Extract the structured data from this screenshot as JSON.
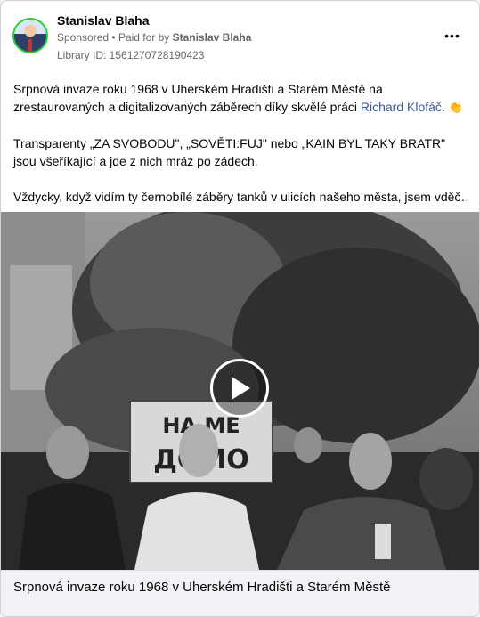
{
  "post": {
    "author_name": "Stanislav Blaha",
    "sponsored_label": "Sponsored",
    "separator": "•",
    "paid_for_prefix": "Paid for by",
    "paid_for_name": "Stanislav Blaha",
    "library_id": "Library ID: 1561270728190423",
    "more_icon": "more-horizontal-icon",
    "more_label": "•••"
  },
  "body": {
    "paragraph1_text": "Srpnová invaze roku 1968 v Uherském Hradišti a Starém Městě na zrestaurovaných a digitalizovaných záběrech díky skvělé práci ",
    "paragraph1_link": "Richard Klofáč",
    "paragraph1_end": ".",
    "clap_emoji": "👏",
    "paragraph2": "Transparenty „ZA SVOBODU\", „SOVĚTI:FUJ\" nebo „KAIN BYL TAKY BRATR\" jsou všeříkající a jde z nich mráz po zádech.",
    "paragraph3": "Vždycky, když vidím ty černobílé záběry tanků v ulicích našeho města, jsem vděč…"
  },
  "video": {
    "sign_text_line1": "НА МЕ",
    "sign_text_line2": "ДОМО",
    "play_icon": "play-icon"
  },
  "caption": {
    "text": "Srpnová invaze roku 1968 v Uherském Hradišti a Starém Městě"
  },
  "colors": {
    "link": "#385898",
    "avatar_ring": "#2ecc40",
    "secondary_text": "#65676b"
  }
}
